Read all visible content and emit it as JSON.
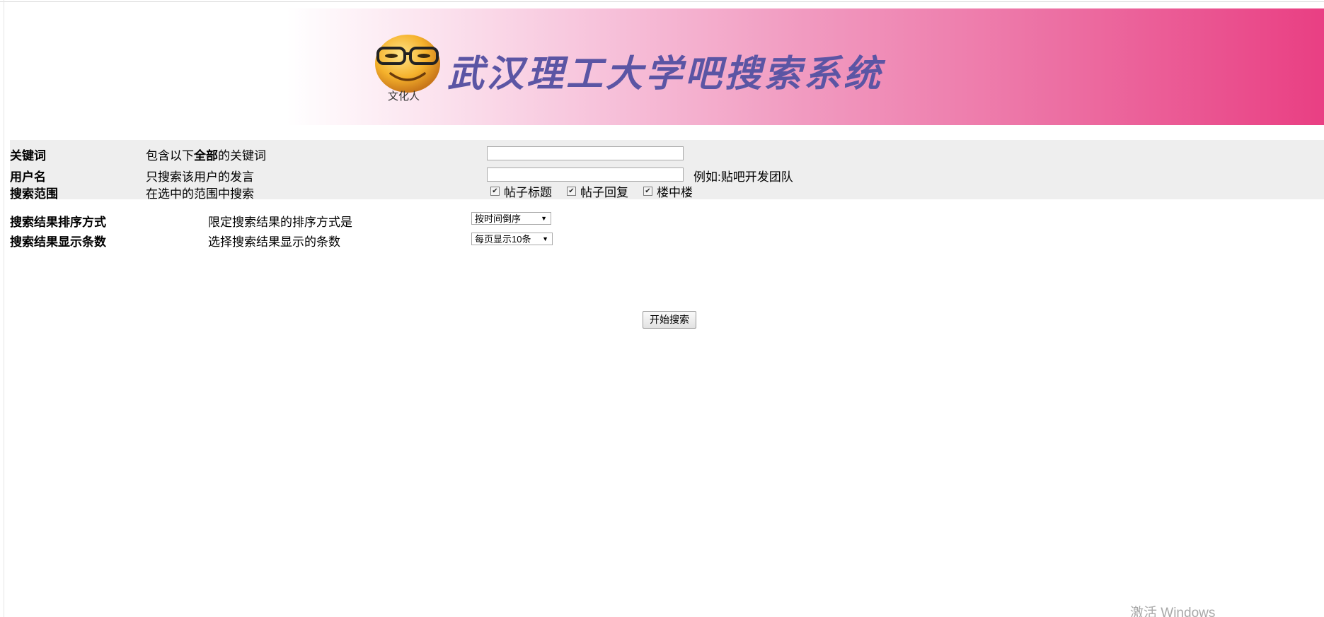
{
  "banner": {
    "logo_caption": "文化人",
    "title": "武汉理工大学吧搜索系统",
    "gradient_colors": [
      "#ffffff",
      "#e93f83"
    ],
    "title_color": "#5b55a4"
  },
  "form": {
    "keyword": {
      "label": "关键词",
      "desc_prefix": "包含以下",
      "desc_bold": "全部",
      "desc_suffix": "的关键词",
      "value": ""
    },
    "username": {
      "label": "用户名",
      "desc": "只搜索该用户的发言",
      "value": "",
      "example": "例如:贴吧开发团队"
    },
    "scope": {
      "label": "搜索范围",
      "desc": "在选中的范围中搜索",
      "options": [
        {
          "label": "帖子标题",
          "checked": true
        },
        {
          "label": "帖子回复",
          "checked": true
        },
        {
          "label": "楼中楼",
          "checked": true
        }
      ]
    },
    "sort": {
      "label": "搜索结果排序方式",
      "desc": "限定搜索结果的排序方式是",
      "selected": "按时间倒序"
    },
    "page_size": {
      "label": "搜索结果显示条数",
      "desc": "选择搜索结果显示的条数",
      "selected": "每页显示10条"
    },
    "submit_label": "开始搜索"
  },
  "os_watermark": "激活 Windows"
}
